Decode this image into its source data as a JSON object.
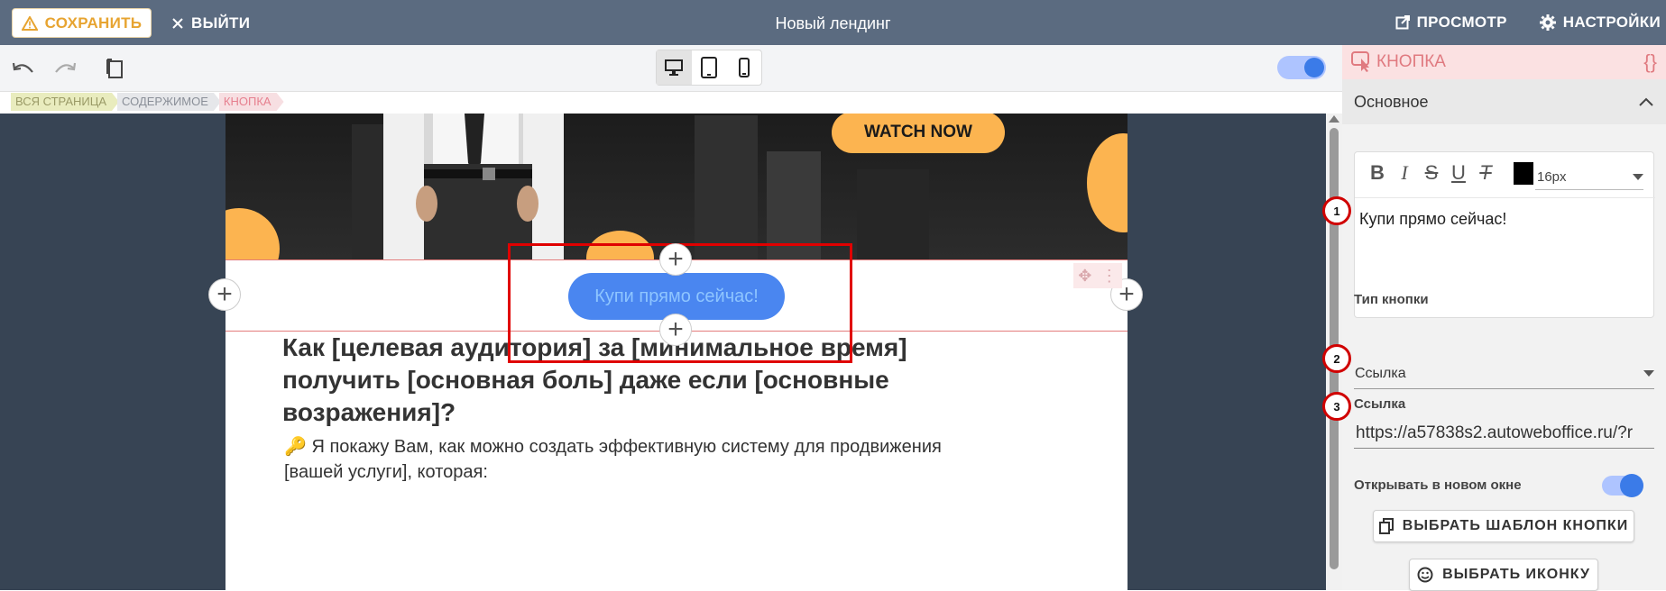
{
  "topbar": {
    "save_label": "СОХРАНИТЬ",
    "exit_label": "ВЫЙТИ",
    "title": "Новый лендинг",
    "preview_label": "ПРОСМОТР",
    "settings_label": "НАСТРОЙКИ"
  },
  "breadcrumbs": [
    "ВСЯ СТРАНИЦА",
    "СОДЕРЖИМОЕ",
    "КНОПКА"
  ],
  "canvas": {
    "hero_button": "WATCH NOW",
    "cta_button": "Купи прямо сейчас!",
    "heading": "Как [целевая аудитория] за [минимальное время] получить [основная боль] даже если [основные возражения]?",
    "paragraph": "🔑 Я покажу Вам, как можно создать эффективную систему для продвижения [вашей услуги], которая:"
  },
  "panel": {
    "title": "КНОПКА",
    "code_icon": "{}",
    "section": "Основное",
    "font_size": "16px",
    "button_text": "Купи прямо сейчас!",
    "type_label": "Тип кнопки",
    "type_value": "Ссылка",
    "link_label": "Ссылка",
    "link_value": "https://a57838s2.autoweboffice.ru/?r",
    "new_window_label": "Открывать в новом окне",
    "template_button": "ВЫБРАТЬ ШАБЛОН КНОПКИ",
    "icon_button": "ВЫБРАТЬ ИКОНКУ",
    "markers": [
      "1",
      "2",
      "3"
    ]
  },
  "colors": {
    "topbar": "#5b6b80",
    "accent_orange": "#e7a431",
    "cta_blue": "#4a86f0",
    "hero_yellow": "#fcb450",
    "selection_red": "#e00000"
  }
}
